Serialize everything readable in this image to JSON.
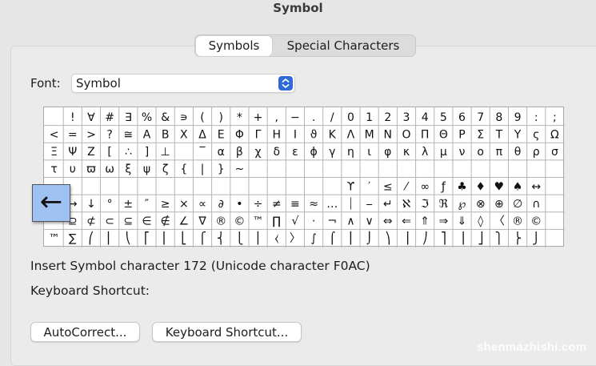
{
  "window": {
    "title": "Symbol"
  },
  "tabs": [
    {
      "label": "Symbols",
      "selected": true
    },
    {
      "label": "Special Characters",
      "selected": false
    }
  ],
  "font": {
    "label": "Font:",
    "value": "Symbol"
  },
  "grid": {
    "rows": [
      [
        " ",
        "!",
        "∀",
        "#",
        "∃",
        "%",
        "&",
        "∍",
        "(",
        ")",
        "*",
        "+",
        ",",
        "−",
        ".",
        "/",
        "0",
        "1",
        "2",
        "3",
        "4",
        "5",
        "6",
        "7",
        "8",
        "9",
        ":",
        ";"
      ],
      [
        "<",
        "=",
        ">",
        "?",
        "≅",
        "Α",
        "Β",
        "Χ",
        "Δ",
        "Ε",
        "Φ",
        "Γ",
        "Η",
        "Ι",
        "ϑ",
        "Κ",
        "Λ",
        "Μ",
        "Ν",
        "Ο",
        "Π",
        "Θ",
        "Ρ",
        "Σ",
        "Τ",
        "Υ",
        "ς",
        "Ω"
      ],
      [
        "Ξ",
        "Ψ",
        "Ζ",
        "[",
        "∴",
        "]",
        "⊥",
        "",
        "‾",
        "α",
        "β",
        "χ",
        "δ",
        "ε",
        "ϕ",
        "γ",
        "η",
        "ι",
        "φ",
        "κ",
        "λ",
        "μ",
        "ν",
        "ο",
        "π",
        "θ",
        "ρ",
        "σ"
      ],
      [
        "τ",
        "υ",
        "ϖ",
        "ω",
        "ξ",
        "ψ",
        "ζ",
        "{",
        "|",
        "}",
        "~",
        "",
        "",
        "",
        "",
        "",
        "",
        "",
        "",
        "",
        "",
        "",
        "",
        "",
        "",
        "",
        "",
        ""
      ],
      [
        "",
        "",
        "",
        "",
        "",
        "",
        "",
        "",
        "",
        "",
        "",
        "",
        "",
        "",
        "",
        "",
        "ϒ",
        "′",
        "≤",
        "⁄",
        "∞",
        "ƒ",
        "♣",
        "♦",
        "♥",
        "♠",
        "↔",
        ""
      ],
      [
        "",
        "→",
        "↓",
        "°",
        "±",
        "″",
        "≥",
        "×",
        "∝",
        "∂",
        "•",
        "÷",
        "≠",
        "≡",
        "≈",
        "…",
        "⏐",
        "⎯",
        "↵",
        "ℵ",
        "ℑ",
        "ℜ",
        "℘",
        "⊗",
        "⊕",
        "∅",
        "∩",
        ""
      ],
      [
        "",
        "⊇",
        "⊄",
        "⊂",
        "⊆",
        "∈",
        "∉",
        "∠",
        "∇",
        "®",
        "©",
        "™",
        "∏",
        "√",
        "⋅",
        "¬",
        "∧",
        "∨",
        "⇔",
        "⇐",
        "⇑",
        "⇒",
        "⇓",
        "◊",
        "〈",
        "®",
        "©",
        ""
      ],
      [
        "™",
        "∑",
        "⎛",
        "⎜",
        "⎝",
        "⎡",
        "⎢",
        "⎣",
        "⎧",
        "⎨",
        "⎩",
        "⎪",
        "⧼",
        "〉",
        "∫",
        "⌠",
        "⎮",
        "⌡",
        "⎞",
        "⎟",
        "⎠",
        "⎤",
        "⎥",
        "⎦",
        "⎫",
        "⎬",
        "⎭",
        ""
      ]
    ]
  },
  "selected_symbol": {
    "glyph": "←"
  },
  "info": {
    "char_text": "Insert Symbol character 172  (Unicode character F0AC)",
    "shortcut_label": "Keyboard Shortcut:"
  },
  "buttons": {
    "autocorrect": "AutoCorrect...",
    "keyboard_shortcut": "Keyboard Shortcut..."
  },
  "watermark": "shenmazhishi.com",
  "colors": {
    "accent": "#2f6ad8",
    "selected_cell": "#9fc2f2"
  }
}
